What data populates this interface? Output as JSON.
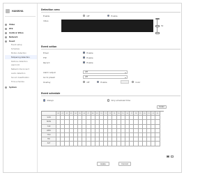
{
  "sidebar": {
    "logo": "HANWHA",
    "items": [
      {
        "label": "Video",
        "level": "top"
      },
      {
        "label": "PTZ",
        "level": "top"
      },
      {
        "label": "Audio & Video",
        "level": "top"
      },
      {
        "label": "Network",
        "level": "top"
      },
      {
        "label": "Event",
        "level": "top",
        "active": true
      },
      {
        "label": "Event setup",
        "level": "sub"
      },
      {
        "label": "Schedule",
        "level": "sub"
      },
      {
        "label": "Motion detection",
        "level": "sub"
      },
      {
        "label": "Tampering detection",
        "level": "sub",
        "active": true
      },
      {
        "label": "Defocus detection",
        "level": "sub"
      },
      {
        "label": "Alarm I/O",
        "level": "sub"
      },
      {
        "label": "Network disconnect",
        "level": "sub"
      },
      {
        "label": "Audio detection",
        "level": "sub"
      },
      {
        "label": "Sound classification",
        "level": "sub"
      },
      {
        "label": "Time schedule",
        "level": "sub"
      },
      {
        "label": "System",
        "level": "top"
      }
    ]
  },
  "detection_area": {
    "title": "Detection area",
    "enable_label": "Enable",
    "off_label": "Off",
    "on_label": "Enable",
    "view_label": "Video",
    "sensitivity_value": "50"
  },
  "event_settings": {
    "title": "Event action",
    "rows": [
      {
        "label": "Email",
        "option": "Enable"
      },
      {
        "label": "FTP",
        "option": "Enable"
      },
      {
        "label": "Record",
        "option": "Enable"
      }
    ],
    "alarm_output_label": "Alarm output",
    "alarm_output_value": "Off",
    "preset_label": "Go to preset",
    "preset_value": "Off",
    "overlay_label": "Overlay",
    "overlay_options": [
      "Off",
      "Enable",
      "Color"
    ]
  },
  "schedule": {
    "title": "Event schedule",
    "always_label": "Always",
    "only_label": "Only scheduled time",
    "detail_button": "Detail",
    "days": [
      "SUN",
      "MON",
      "TUE",
      "WED",
      "THU",
      "FRI",
      "SAT"
    ],
    "hours": [
      "00",
      "01",
      "02",
      "03",
      "04",
      "05",
      "06",
      "07",
      "08",
      "09",
      "10",
      "11",
      "12",
      "13",
      "14",
      "15",
      "16",
      "17",
      "18",
      "19",
      "20",
      "21",
      "22",
      "23"
    ]
  },
  "buttons": {
    "apply": "Apply",
    "cancel": "Cancel"
  },
  "colors": {
    "accent": "#3a6fd8",
    "video_area": "#1c1c1c"
  }
}
